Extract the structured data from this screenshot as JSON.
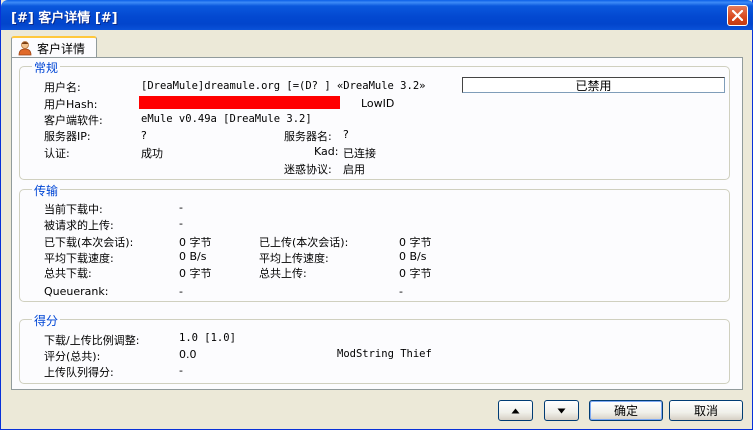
{
  "window": {
    "title": "[#] 客户详情 [#]"
  },
  "tab": {
    "label": "客户详情"
  },
  "general": {
    "legend": "常规",
    "username_label": "用户名:",
    "username_value": "[DreaMule]dreamule.org [=(D? ] «DreaMule 3.2»",
    "banned_status": "已禁用",
    "userhash_label": "用户Hash:",
    "id_type": "LowID",
    "client_software_label": "客户端软件:",
    "client_software_value": "eMule v0.49a [DreaMule 3.2]",
    "server_ip_label": "服务器IP:",
    "server_ip_value": "?",
    "server_name_label": "服务器名:",
    "server_name_value": "?",
    "auth_label": "认证:",
    "auth_value": "成功",
    "kad_label": "Kad:",
    "kad_value": "已连接",
    "obfuscation_label": "迷惑协议:",
    "obfuscation_value": "启用"
  },
  "transfer": {
    "legend": "传输",
    "current_download_label": "当前下载中:",
    "current_download_value": "-",
    "requested_upload_label": "被请求的上传:",
    "requested_upload_value": "-",
    "downloaded_session_label": "已下载(本次会话):",
    "downloaded_session_value": "0 字节",
    "uploaded_session_label": "已上传(本次会话):",
    "uploaded_session_value": "0 字节",
    "avg_download_label": "平均下载速度:",
    "avg_download_value": "0 B/s",
    "avg_upload_label": "平均上传速度:",
    "avg_upload_value": "0 B/s",
    "total_download_label": "总共下载:",
    "total_download_value": "0 字节",
    "total_upload_label": "总共上传:",
    "total_upload_value": "0 字节",
    "queuerank_label": "Queuerank:",
    "queuerank_value": "-",
    "queuerank_value2": "-"
  },
  "score": {
    "legend": "得分",
    "ratio_label": "下载/上传比例调整:",
    "ratio_value": "1.0 [1.0]",
    "rating_label": "评分(总共):",
    "rating_value": "0.0",
    "modstring_value": "ModString Thief",
    "queue_score_label": "上传队列得分:",
    "queue_score_value": "-"
  },
  "buttons": {
    "prev_icon": "arrow-up-icon",
    "next_icon": "arrow-down-icon",
    "ok_label": "确定",
    "cancel_label": "取消"
  }
}
